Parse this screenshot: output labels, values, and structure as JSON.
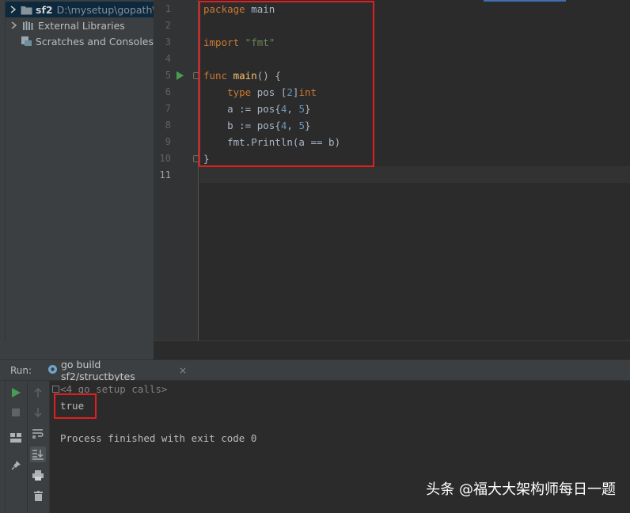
{
  "project_tree": {
    "items": [
      {
        "name": "sf2",
        "path": "D:\\mysetup\\gopath\\s",
        "expanded": false,
        "selected": true,
        "icon": "folder-icon"
      },
      {
        "label": "External Libraries",
        "icon": "libraries-icon"
      },
      {
        "label": "Scratches and Consoles",
        "icon": "scratches-icon"
      }
    ]
  },
  "editor": {
    "line_numbers": [
      "1",
      "2",
      "3",
      "4",
      "5",
      "6",
      "7",
      "8",
      "9",
      "10",
      "11"
    ],
    "current_line": "11",
    "code": {
      "l1_kw": "package",
      "l1_rest": " main",
      "l3_kw": "import",
      "l3_str": " \"fmt\"",
      "l5_kw": "func",
      "l5_fn": " main",
      "l5_rest": "() {",
      "l6_kw": "type",
      "l6_a": " pos [",
      "l6_num": "2",
      "l6_b": "]",
      "l6_kw2": "int",
      "l7_a": "    a := pos{",
      "l7_n1": "4",
      "l7_c": ", ",
      "l7_n2": "5",
      "l7_e": "}",
      "l8_a": "    b := pos{",
      "l8_n1": "4",
      "l8_c": ", ",
      "l8_n2": "5",
      "l8_e": "}",
      "l9": "    fmt.Println(a == b)",
      "l10": "}"
    }
  },
  "run_window": {
    "label": "Run:",
    "tab": {
      "title": "go build sf2/structbytes",
      "close": "×"
    },
    "console": {
      "folded": "<4 go setup calls>",
      "output": "true",
      "exit": "Process finished with exit code 0"
    }
  },
  "watermark": "头条 @福大大架构师每日一题",
  "colors": {
    "highlight_box": "#e02020",
    "keyword": "#cc7832",
    "string": "#6a8759",
    "number": "#6897bb",
    "function": "#ffc66d"
  }
}
